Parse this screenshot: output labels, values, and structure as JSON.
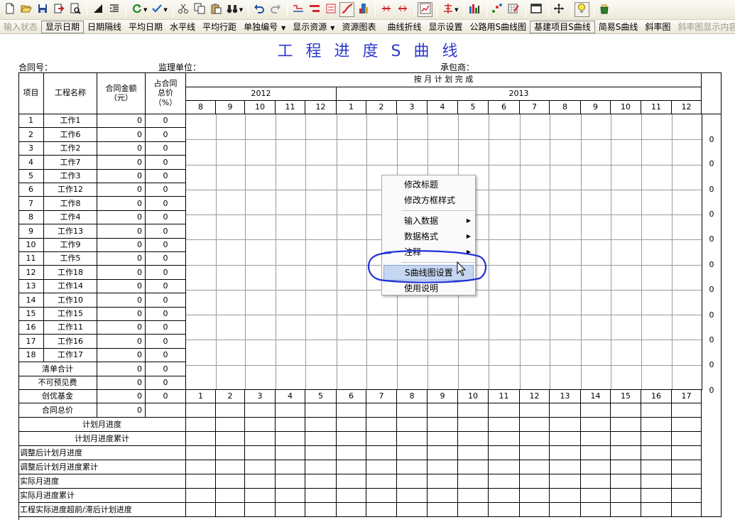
{
  "toolbar": {
    "icons": [
      "new-file-icon",
      "open-folder-icon",
      "save-icon",
      "export-icon",
      "print-preview-icon",
      "triangle-icon",
      "indent-icon",
      "refresh-icon",
      "check-icon",
      "cut-icon",
      "copy-icon",
      "paste-icon",
      "binoculars-icon",
      "undo-icon",
      "redo-icon",
      "line-style-icon",
      "bar-style-icon",
      "form-icon",
      "curve-icon",
      "tower-icon",
      "compress-icon",
      "expand-icon",
      "chart-check-icon",
      "align-icon",
      "column-chart-icon",
      "scatter-icon",
      "grid-edit-icon",
      "window-icon",
      "move-icon",
      "bulb-icon",
      "bucket-icon"
    ]
  },
  "toolbar2": {
    "items": [
      {
        "label": "输入状态",
        "disabled": true
      },
      {
        "label": "显示日期",
        "pressed": true
      },
      {
        "label": "日期隔线"
      },
      {
        "label": "平均日期"
      },
      {
        "label": "水平线"
      },
      {
        "label": "平均行距"
      },
      {
        "label": "单独编号",
        "dropdown": true
      },
      {
        "label": "显示资源",
        "dropdown": true
      },
      {
        "label": "资源图表"
      },
      {
        "sep": true
      },
      {
        "label": "曲线折线"
      },
      {
        "label": "显示设置"
      },
      {
        "label": "公路用S曲线图"
      },
      {
        "label": "基建项目S曲线",
        "pressed": true
      },
      {
        "label": "简易S曲线"
      },
      {
        "label": "斜率图"
      },
      {
        "label": "斜率图显示内容",
        "disabled": true
      }
    ]
  },
  "document": {
    "title": "工程进度S曲线",
    "contract_no_label": "合同号：",
    "supervisor_label": "监理单位：",
    "contractor_label": "承包商："
  },
  "table": {
    "headers": {
      "item": "项目",
      "name": "工程名称",
      "amount": "合同金额\n（元）",
      "percent": "占合同\n总价\n（%）",
      "monthly_plan": "按 月 计 划 完 成"
    },
    "years": [
      {
        "label": "2012"
      },
      {
        "label": "2013"
      }
    ],
    "months": [
      "8",
      "9",
      "10",
      "11",
      "12",
      "1",
      "2",
      "3",
      "4",
      "5",
      "6",
      "7",
      "8",
      "9",
      "10",
      "11",
      "12"
    ],
    "rows": [
      {
        "no": "1",
        "name": "工作1",
        "amount": "0",
        "pct": "0"
      },
      {
        "no": "2",
        "name": "工作6",
        "amount": "0",
        "pct": "0"
      },
      {
        "no": "3",
        "name": "工作2",
        "amount": "0",
        "pct": "0"
      },
      {
        "no": "4",
        "name": "工作7",
        "amount": "0",
        "pct": "0"
      },
      {
        "no": "5",
        "name": "工作3",
        "amount": "0",
        "pct": "0"
      },
      {
        "no": "6",
        "name": "工作12",
        "amount": "0",
        "pct": "0"
      },
      {
        "no": "7",
        "name": "工作8",
        "amount": "0",
        "pct": "0"
      },
      {
        "no": "8",
        "name": "工作4",
        "amount": "0",
        "pct": "0"
      },
      {
        "no": "9",
        "name": "工作13",
        "amount": "0",
        "pct": "0"
      },
      {
        "no": "10",
        "name": "工作9",
        "amount": "0",
        "pct": "0"
      },
      {
        "no": "11",
        "name": "工作5",
        "amount": "0",
        "pct": "0"
      },
      {
        "no": "12",
        "name": "工作18",
        "amount": "0",
        "pct": "0"
      },
      {
        "no": "13",
        "name": "工作14",
        "amount": "0",
        "pct": "0"
      },
      {
        "no": "14",
        "name": "工作10",
        "amount": "0",
        "pct": "0"
      },
      {
        "no": "15",
        "name": "工作15",
        "amount": "0",
        "pct": "0"
      },
      {
        "no": "16",
        "name": "工作11",
        "amount": "0",
        "pct": "0"
      },
      {
        "no": "17",
        "name": "工作16",
        "amount": "0",
        "pct": "0"
      },
      {
        "no": "18",
        "name": "工作17",
        "amount": "0",
        "pct": "0"
      }
    ],
    "summary_rows": [
      {
        "label": "清单合计",
        "amount": "0",
        "pct": "0"
      },
      {
        "label": "不可预见费",
        "amount": "0",
        "pct": "0"
      },
      {
        "label": "创优基金",
        "amount": "0",
        "pct": "0"
      },
      {
        "label": "合同总价",
        "amount": "0"
      }
    ],
    "period_numbers": [
      "1",
      "2",
      "3",
      "4",
      "5",
      "6",
      "7",
      "8",
      "9",
      "10",
      "11",
      "12",
      "13",
      "14",
      "15",
      "16",
      "17"
    ],
    "progress_rows": [
      {
        "label": "计划月进度",
        "align": "center"
      },
      {
        "label": "计划月进度累计",
        "align": "center"
      },
      {
        "label": "调整后计划月进度",
        "align": "left"
      },
      {
        "label": "调整后计划月进度累计",
        "align": "left"
      },
      {
        "label": "实际月进度",
        "align": "left"
      },
      {
        "label": "实际月进度累计",
        "align": "left"
      },
      {
        "label": "工程实际进度超前/滞后计划进度",
        "align": "left"
      }
    ],
    "right_axis_values": [
      "0",
      "0",
      "0",
      "0",
      "0",
      "0",
      "0",
      "0",
      "0",
      "0",
      "0"
    ]
  },
  "context_menu": {
    "items": [
      {
        "label": "修改标题"
      },
      {
        "label": "修改方框样式"
      },
      {
        "sep": true
      },
      {
        "label": "输入数据",
        "submenu": true
      },
      {
        "label": "数据格式",
        "submenu": true
      },
      {
        "label": "注释",
        "submenu": true
      },
      {
        "sep": true
      },
      {
        "label": "S曲线图设置",
        "highlighted": true
      },
      {
        "label": "使用说明"
      }
    ]
  },
  "colors": {
    "title": "#2e39c8",
    "highlight_ring": "#1e2fd6",
    "menu_highlight": "#c6d7f2"
  }
}
